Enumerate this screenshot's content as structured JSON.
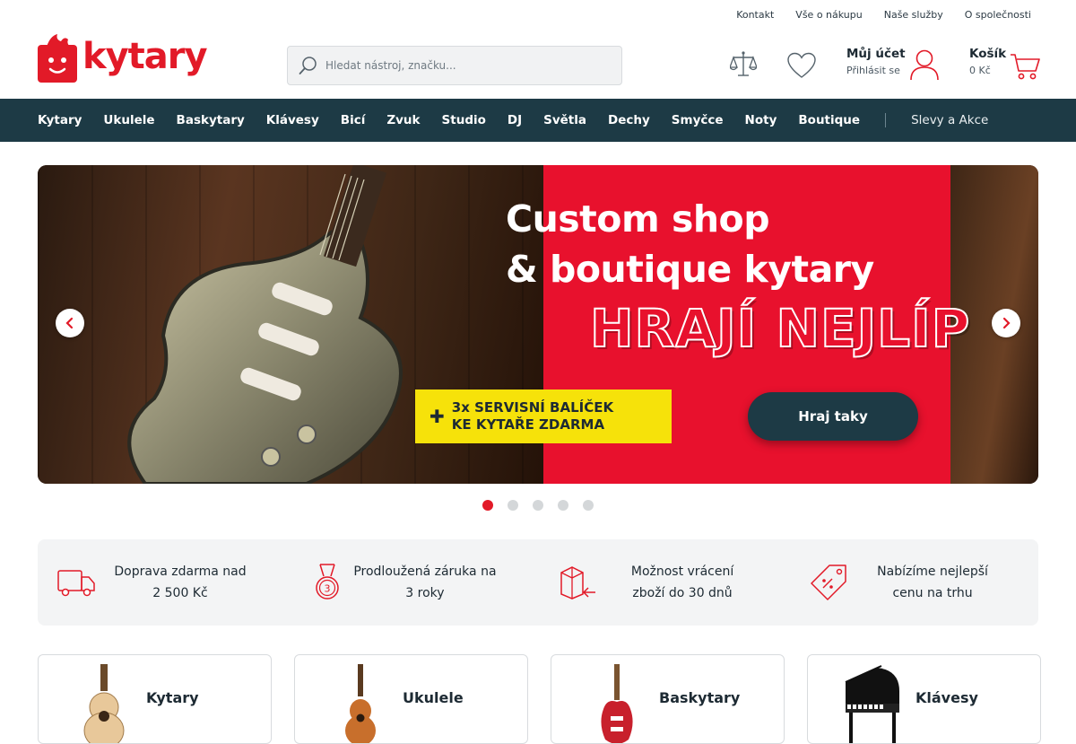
{
  "topbar": {
    "links": [
      "Kontakt",
      "Vše o nákupu",
      "Naše služby",
      "O společnosti"
    ]
  },
  "header": {
    "logo_text": "kytary",
    "search_placeholder": "Hledat nástroj, značku...",
    "account_title": "Můj účet",
    "account_sub": "Přihlásit se",
    "cart_title": "Košík",
    "cart_total": "0 Kč"
  },
  "nav": {
    "items": [
      "Kytary",
      "Ukulele",
      "Baskytary",
      "Klávesy",
      "Bicí",
      "Zvuk",
      "Studio",
      "DJ",
      "Světla",
      "Dechy",
      "Smyčce",
      "Noty",
      "Boutique"
    ],
    "sale": "Slevy a Akce"
  },
  "hero": {
    "title_line1": "Custom shop",
    "title_line2": "& boutique kytary",
    "big": "HRAJÍ NEJLÍP",
    "promo_line1": "3x SERVISNÍ BALÍČEK",
    "promo_line2": "KE KYTAŘE ZDARMA",
    "cta": "Hraj taky",
    "slide_count": 5,
    "active_slide": 1
  },
  "benefits": [
    {
      "icon": "truck-icon",
      "line1": "Doprava zdarma nad",
      "line2": "2 500 Kč"
    },
    {
      "icon": "medal-icon",
      "line1": "Prodloužená záruka na",
      "line2": "3 roky"
    },
    {
      "icon": "return-box-icon",
      "line1": "Možnost vrácení",
      "line2": "zboží do 30 dnů"
    },
    {
      "icon": "price-tag-icon",
      "line1": "Nabízíme nejlepší",
      "line2": "cenu na trhu"
    }
  ],
  "categories": [
    {
      "label": "Kytary",
      "icon": "acoustic-guitar-icon"
    },
    {
      "label": "Ukulele",
      "icon": "ukulele-icon"
    },
    {
      "label": "Baskytary",
      "icon": "bass-guitar-icon"
    },
    {
      "label": "Klávesy",
      "icon": "grand-piano-icon"
    }
  ],
  "colors": {
    "brand_red": "#e21a28",
    "nav_bg": "#1d3a45",
    "promo_yellow": "#f6e20a"
  }
}
